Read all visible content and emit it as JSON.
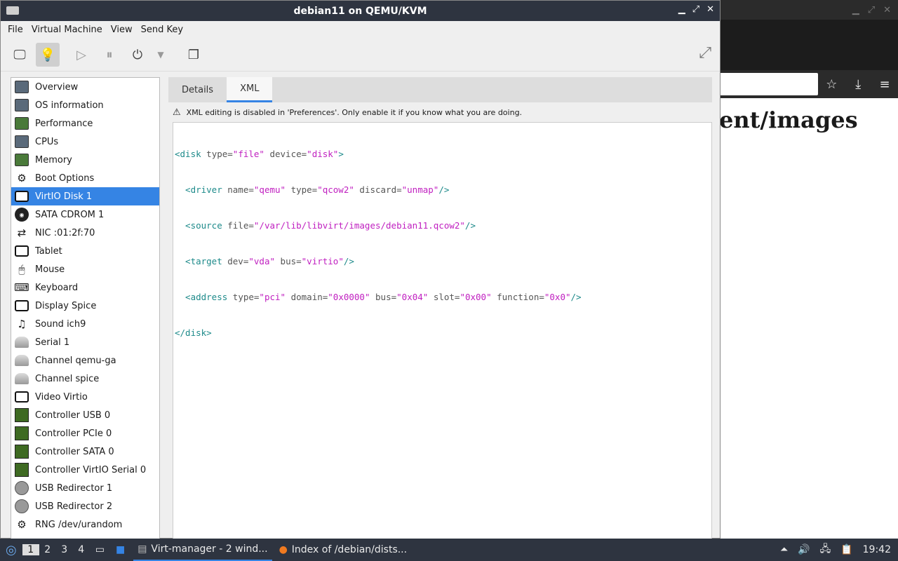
{
  "window": {
    "title": "debian11 on QEMU/KVM",
    "minimize": "▁",
    "maximize": "⤢",
    "close": "✕"
  },
  "menubar": [
    "File",
    "Virtual Machine",
    "View",
    "Send Key"
  ],
  "toolbar": {
    "icons": [
      "monitor-icon",
      "bulb-icon",
      "play-icon",
      "pause-icon",
      "power-icon",
      "dropdown-icon",
      "snapshot-icon",
      "fullscreen-icon"
    ]
  },
  "sidebar": {
    "items": [
      {
        "label": "Overview",
        "icon": "box"
      },
      {
        "label": "OS information",
        "icon": "box"
      },
      {
        "label": "Performance",
        "icon": "green"
      },
      {
        "label": "CPUs",
        "icon": "box"
      },
      {
        "label": "Memory",
        "icon": "green"
      },
      {
        "label": "Boot Options",
        "icon": "gear"
      },
      {
        "label": "VirtIO Disk 1",
        "icon": "disk"
      },
      {
        "label": "SATA CDROM 1",
        "icon": "cd"
      },
      {
        "label": "NIC :01:2f:70",
        "icon": "nic"
      },
      {
        "label": "Tablet",
        "icon": "rect"
      },
      {
        "label": "Mouse",
        "icon": "mouse"
      },
      {
        "label": "Keyboard",
        "icon": "keyboard"
      },
      {
        "label": "Display Spice",
        "icon": "rect"
      },
      {
        "label": "Sound ich9",
        "icon": "sound"
      },
      {
        "label": "Serial 1",
        "icon": "cable"
      },
      {
        "label": "Channel qemu-ga",
        "icon": "cable"
      },
      {
        "label": "Channel spice",
        "icon": "cable"
      },
      {
        "label": "Video Virtio",
        "icon": "rect"
      },
      {
        "label": "Controller USB 0",
        "icon": "ctrl"
      },
      {
        "label": "Controller PCIe 0",
        "icon": "ctrl"
      },
      {
        "label": "Controller SATA 0",
        "icon": "ctrl"
      },
      {
        "label": "Controller VirtIO Serial 0",
        "icon": "ctrl"
      },
      {
        "label": "USB Redirector 1",
        "icon": "usb"
      },
      {
        "label": "USB Redirector 2",
        "icon": "usb"
      },
      {
        "label": "RNG /dev/urandom",
        "icon": "gear"
      }
    ],
    "selected": 6
  },
  "tabs": {
    "details": "Details",
    "xml": "XML",
    "active": "xml"
  },
  "warning": "XML editing is disabled in 'Preferences'. Only enable it if you know what you are doing.",
  "xml": {
    "l1": {
      "open": "<disk",
      "a1": " type=",
      "v1": "\"file\"",
      "a2": " device=",
      "v2": "\"disk\"",
      "close": ">"
    },
    "l2": {
      "open": "  <driver",
      "a1": " name=",
      "v1": "\"qemu\"",
      "a2": " type=",
      "v2": "\"qcow2\"",
      "a3": " discard=",
      "v3": "\"unmap\"",
      "close": "/>"
    },
    "l3": {
      "open": "  <source",
      "a1": " file=",
      "v1": "\"/var/lib/libvirt/images/debian11.qcow2\"",
      "close": "/>"
    },
    "l4": {
      "open": "  <target",
      "a1": " dev=",
      "v1": "\"vda\"",
      "a2": " bus=",
      "v2": "\"virtio\"",
      "close": "/>"
    },
    "l5": {
      "open": "  <address",
      "a1": " type=",
      "v1": "\"pci\"",
      "a2": " domain=",
      "v2": "\"0x0000\"",
      "a3": " bus=",
      "v3": "\"0x04\"",
      "a4": " slot=",
      "v4": "\"0x00\"",
      "a5": " function=",
      "v5": "\"0x0\"",
      "close": "/>"
    },
    "l6": {
      "open": "</disk>"
    }
  },
  "background": {
    "heading": "ent/images"
  },
  "taskbar": {
    "workspaces": [
      "1",
      "2",
      "3",
      "4"
    ],
    "tasks": [
      "Virt-manager - 2 wind...",
      "Index of /debian/dists..."
    ],
    "clock": "19:42"
  }
}
